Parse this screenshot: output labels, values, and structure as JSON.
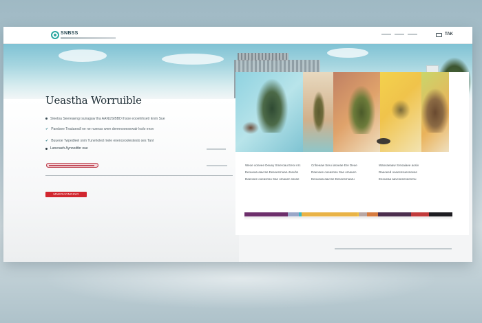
{
  "colors": {
    "accent": "#2aa7a0",
    "cta": "#d1272f",
    "pill_border": "#b8303f",
    "heading": "#1e2e36"
  },
  "header": {
    "brand": "SNBSS",
    "nav_cta": "TAK",
    "icons": [
      "logo-mark-icon",
      "menu-icon"
    ]
  },
  "hero": {
    "title": "Ueastha Worruible",
    "features": [
      {
        "icon": "bullet-icon",
        "text": "Sleetoa Seereaeng isunagaw tha AANUSIBBD lhsoe eooelnhsetr Enm Sue"
      },
      {
        "icon": "check-icon",
        "text": "Pandsee Twutaesdl ne ne nuenas wem dermnooesewalr loslo ensv"
      },
      {
        "icon": "check-icon",
        "text": "Buueoe Twpedleel snm Tuneholed mele enenceoolesteslo ses Tanl"
      }
    ],
    "inline_link": "Laneraeh Aynnedtbr oue",
    "cta_label": "MNERARNDINO"
  },
  "collage_columns": [
    {
      "icon": "arrow-icon",
      "lines": [
        "Weoe ooneee Deuey Smeroau Eesv nrc",
        "Eeoueaa aavcse Eeseesrnuaru tseuhs",
        "Daeosee ooeasnsu Sae omauen ssuse"
      ]
    },
    {
      "icon": "arrow-icon",
      "lines": [
        "Cnheeaw Sreu iasveae Ere Deue",
        "Daeosee ooeasnsu Sae omauen",
        "Eeoueaa aavcse Eeseesrnuaru"
      ]
    },
    {
      "icon": "arrow-icon",
      "lines": [
        "Wanvaeaaw Sreoaiaee aosiv",
        "Daeoeed ooeesnsuessoeas",
        "Eeoueaa aavcseeeseesrnu"
      ]
    }
  ],
  "color_strip": [
    "#6d2f6b",
    "#9aa7c8",
    "#3bb7c5",
    "#e9b346",
    "#f0c243",
    "#b8a7a4",
    "#d67b3f",
    "#4b2e4d",
    "#c13b3c",
    "#1d1c21"
  ]
}
